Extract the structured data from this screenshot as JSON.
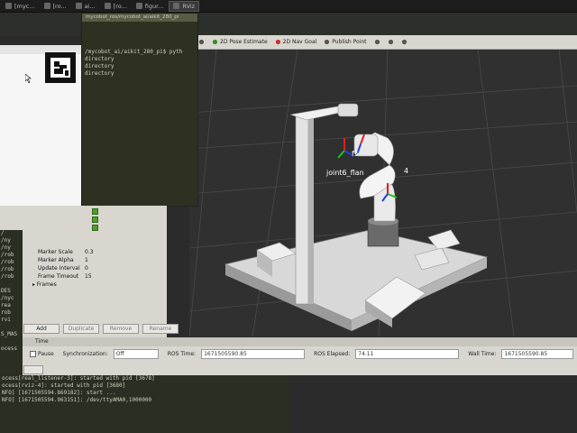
{
  "taskbar": {
    "items": [
      {
        "label": "[myc...",
        "active": false
      },
      {
        "label": "[ro...",
        "active": false
      },
      {
        "label": "ai...",
        "active": false
      },
      {
        "label": "[ro...",
        "active": false
      },
      {
        "label": "figur...",
        "active": false
      },
      {
        "label": "RViz",
        "active": true
      }
    ]
  },
  "terminal": {
    "title": "mycobot_ros/mycobot_ai/aikit_280_pi",
    "prompt_line": "/mycobot_ai/aikit_280_pi$ pyth",
    "lines": [
      "directory",
      "directory",
      "directory"
    ]
  },
  "rviz_toolbar": {
    "tools": [
      {
        "icon": "arrow-icon",
        "label": ""
      },
      {
        "icon": "pose-estimate-icon",
        "label": "2D Pose Estimate"
      },
      {
        "icon": "nav-goal-icon",
        "label": "2D Nav Goal"
      },
      {
        "icon": "publish-point-icon",
        "label": "Publish Point"
      },
      {
        "icon": "plus-icon",
        "label": ""
      },
      {
        "icon": "minus-icon",
        "label": ""
      },
      {
        "icon": "camera-icon",
        "label": ""
      }
    ]
  },
  "viewport": {
    "frame_labels": [
      "joint6_flan",
      "4",
      "f5"
    ]
  },
  "displays": {
    "properties": [
      {
        "key": "Marker Scale",
        "value": "0.3"
      },
      {
        "key": "Marker Alpha",
        "value": "1"
      },
      {
        "key": "Update Interval",
        "value": "0"
      },
      {
        "key": "Frame Timeout",
        "value": "15"
      },
      {
        "key": "Frames",
        "value": ""
      }
    ],
    "buttons": [
      "Add",
      "Duplicate",
      "Remove",
      "Rename"
    ]
  },
  "time_panel": {
    "title": "Time",
    "pause_label": "Pause",
    "sync_label": "Synchronization:",
    "sync_value": "Off",
    "ros_time_label": "ROS Time:",
    "ros_time_value": "1671505590.85",
    "ros_elapsed_label": "ROS Elapsed:",
    "ros_elapsed_value": "74.11",
    "wall_time_label": "Wall Time:",
    "wall_time_value": "1671505590.85",
    "reset_label": "Reset"
  },
  "bottom_terminal": {
    "lines": [
      "ocess[real_listener-3]: started with pid [3678]",
      "ocess[rviz-4]: started with pid [3680]",
      "NFO] [1671505594.869182]: start ...",
      "NFO] [1671505594.963151]: /dev/ttyAMA0,1000000"
    ]
  },
  "left_strip": {
    "lines": [
      "/",
      "/ny",
      "/ny",
      "/rob",
      "/rob",
      "/rob",
      "/rob",
      "",
      "DES",
      "/nyc",
      "rea",
      "rob",
      "rvi",
      "",
      "S_MAS",
      "",
      "ocess"
    ]
  },
  "colors": {
    "viewport_bg": "#303030",
    "panel_bg": "#d9d6d0",
    "terminal_bg": "#2e3122",
    "check_green": "#4f9d2e"
  }
}
